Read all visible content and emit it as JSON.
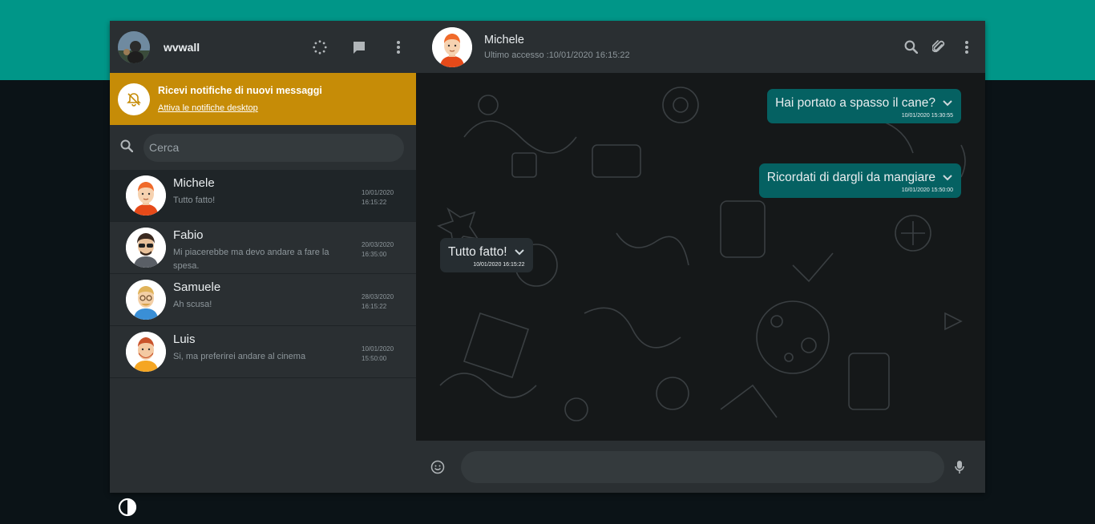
{
  "colors": {
    "brand_band": "#009688",
    "notify_bg": "#c68c07",
    "out_bubble": "#056162",
    "in_bubble": "#262d31"
  },
  "sidebar": {
    "username": "wvwall",
    "header_icons": [
      "status-icon",
      "new-chat-icon",
      "menu-icon"
    ],
    "notification": {
      "icon": "bell-off-icon",
      "title": "Ricevi notifiche di nuovi messaggi",
      "link": "Attiva le notifiche desktop"
    },
    "search": {
      "icon": "search-icon",
      "placeholder": "Cerca"
    },
    "contacts": [
      {
        "name": "Michele",
        "last_message": "Tutto fatto!",
        "date": "10/01/2020",
        "time": "16:15:22",
        "active": true
      },
      {
        "name": "Fabio",
        "last_message": "Mi piacerebbe ma devo andare a fare la spesa.",
        "date": "20/03/2020",
        "time": "16:35:00",
        "active": false
      },
      {
        "name": "Samuele",
        "last_message": "Ah scusa!",
        "date": "28/03/2020",
        "time": "16:15:22",
        "active": false
      },
      {
        "name": "Luis",
        "last_message": "Si, ma preferirei andare al cinema",
        "date": "10/01/2020",
        "time": "15:50:00",
        "active": false
      }
    ]
  },
  "chat": {
    "contact_name": "Michele",
    "last_seen": "Ultimo accesso :10/01/2020 16:15:22",
    "header_icons": [
      "search-icon",
      "attach-icon",
      "menu-icon"
    ],
    "messages": [
      {
        "direction": "out",
        "text": "Hai portato a spasso il cane?",
        "timestamp": "10/01/2020 15:30:55"
      },
      {
        "direction": "out",
        "text": "Ricordati di dargli da mangiare",
        "timestamp": "10/01/2020 15:50:00"
      },
      {
        "direction": "in",
        "text": "Tutto fatto!",
        "timestamp": "10/01/2020 16:15:22"
      }
    ],
    "composer": {
      "emoji_icon": "emoji-icon",
      "placeholder": "",
      "mic_icon": "mic-icon"
    }
  },
  "theme_toggle_icon": "contrast-icon"
}
